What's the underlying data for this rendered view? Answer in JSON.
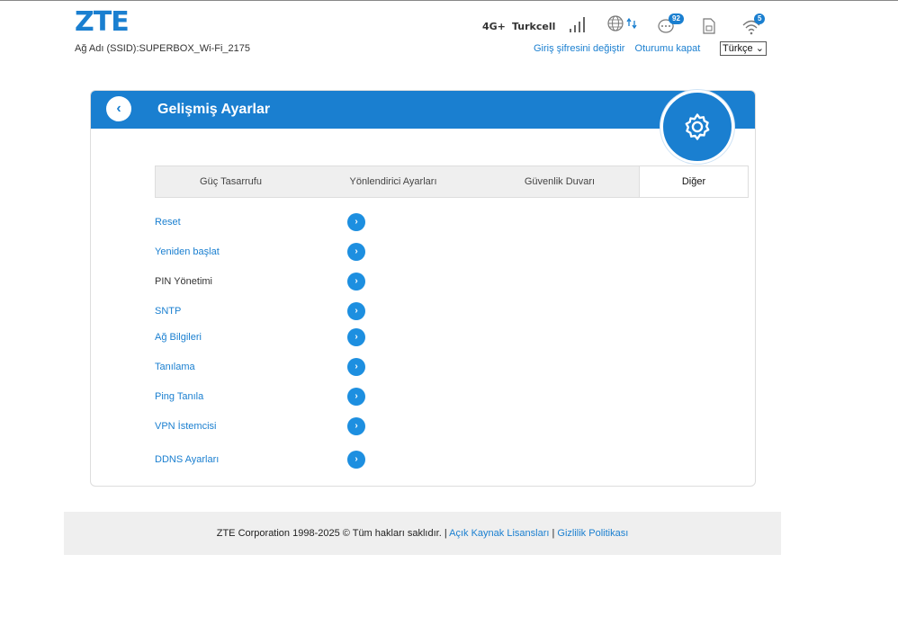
{
  "header": {
    "logo": "ZTE",
    "ssid": "Ağ Adı (SSID):SUPERBOX_Wi-Fi_2175",
    "network_type": "4G+",
    "operator": "Turkcell",
    "sms_count": "92",
    "wifi_clients": "5",
    "change_password": "Giriş şifresini değiştir",
    "logout": "Oturumu kapat",
    "language": "Türkçe"
  },
  "card": {
    "back_label": "‹",
    "title": "Gelişmiş Ayarlar"
  },
  "tabs": [
    {
      "label": "Güç Tasarrufu",
      "active": false
    },
    {
      "label": "Yönlendirici Ayarları",
      "active": false
    },
    {
      "label": "Güvenlik Duvarı",
      "active": false
    },
    {
      "label": "Diğer",
      "active": true
    }
  ],
  "menu": [
    {
      "label": "Reset"
    },
    {
      "label": "Yeniden başlat"
    },
    {
      "label": "PIN Yönetimi"
    },
    {
      "label": "SNTP"
    },
    {
      "label": "Ağ Bilgileri"
    },
    {
      "label": "Tanılama"
    },
    {
      "label": "Ping Tanıla"
    },
    {
      "label": "VPN İstemcisi"
    },
    {
      "label": "DDNS Ayarları"
    }
  ],
  "footer": {
    "copyright": "ZTE Corporation 1998-2025 © Tüm hakları saklıdır.",
    "sep1": " | ",
    "open_source": "Açık Kaynak Lisansları",
    "sep2": " | ",
    "privacy": "Gizlilik Politikası"
  },
  "colors": {
    "accent": "#1a7fd0",
    "footer_bg": "#efefef"
  }
}
